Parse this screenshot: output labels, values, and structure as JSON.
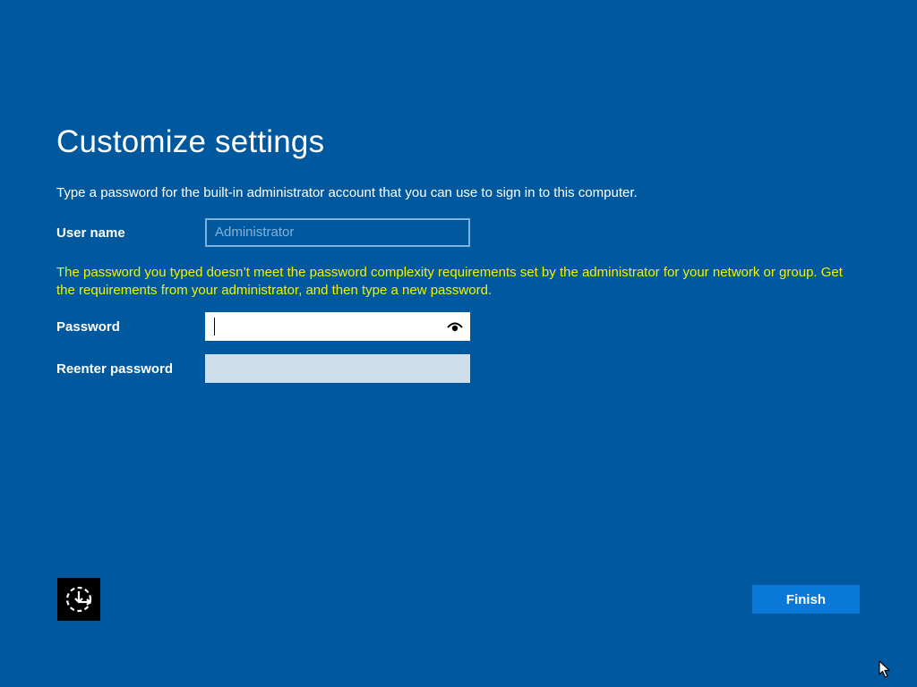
{
  "page": {
    "title": "Customize settings",
    "instruction": "Type a password for the built-in administrator account that you can use to sign in to this computer."
  },
  "username": {
    "label": "User name",
    "value": "Administrator"
  },
  "error": {
    "message": "The password you typed doesn’t meet the password complexity requirements set by the administrator for your network or group. Get the requirements from your administrator, and then type a new password."
  },
  "password": {
    "label": "Password",
    "value": "",
    "reveal_icon": "eye-icon"
  },
  "reenter_password": {
    "label": "Reenter password",
    "value": ""
  },
  "footer": {
    "ease_of_access_icon": "ease-of-access-icon",
    "finish_label": "Finish"
  },
  "colors": {
    "background": "#00599e",
    "error_text": "#f2f200",
    "finish_button": "#0a78d7"
  }
}
